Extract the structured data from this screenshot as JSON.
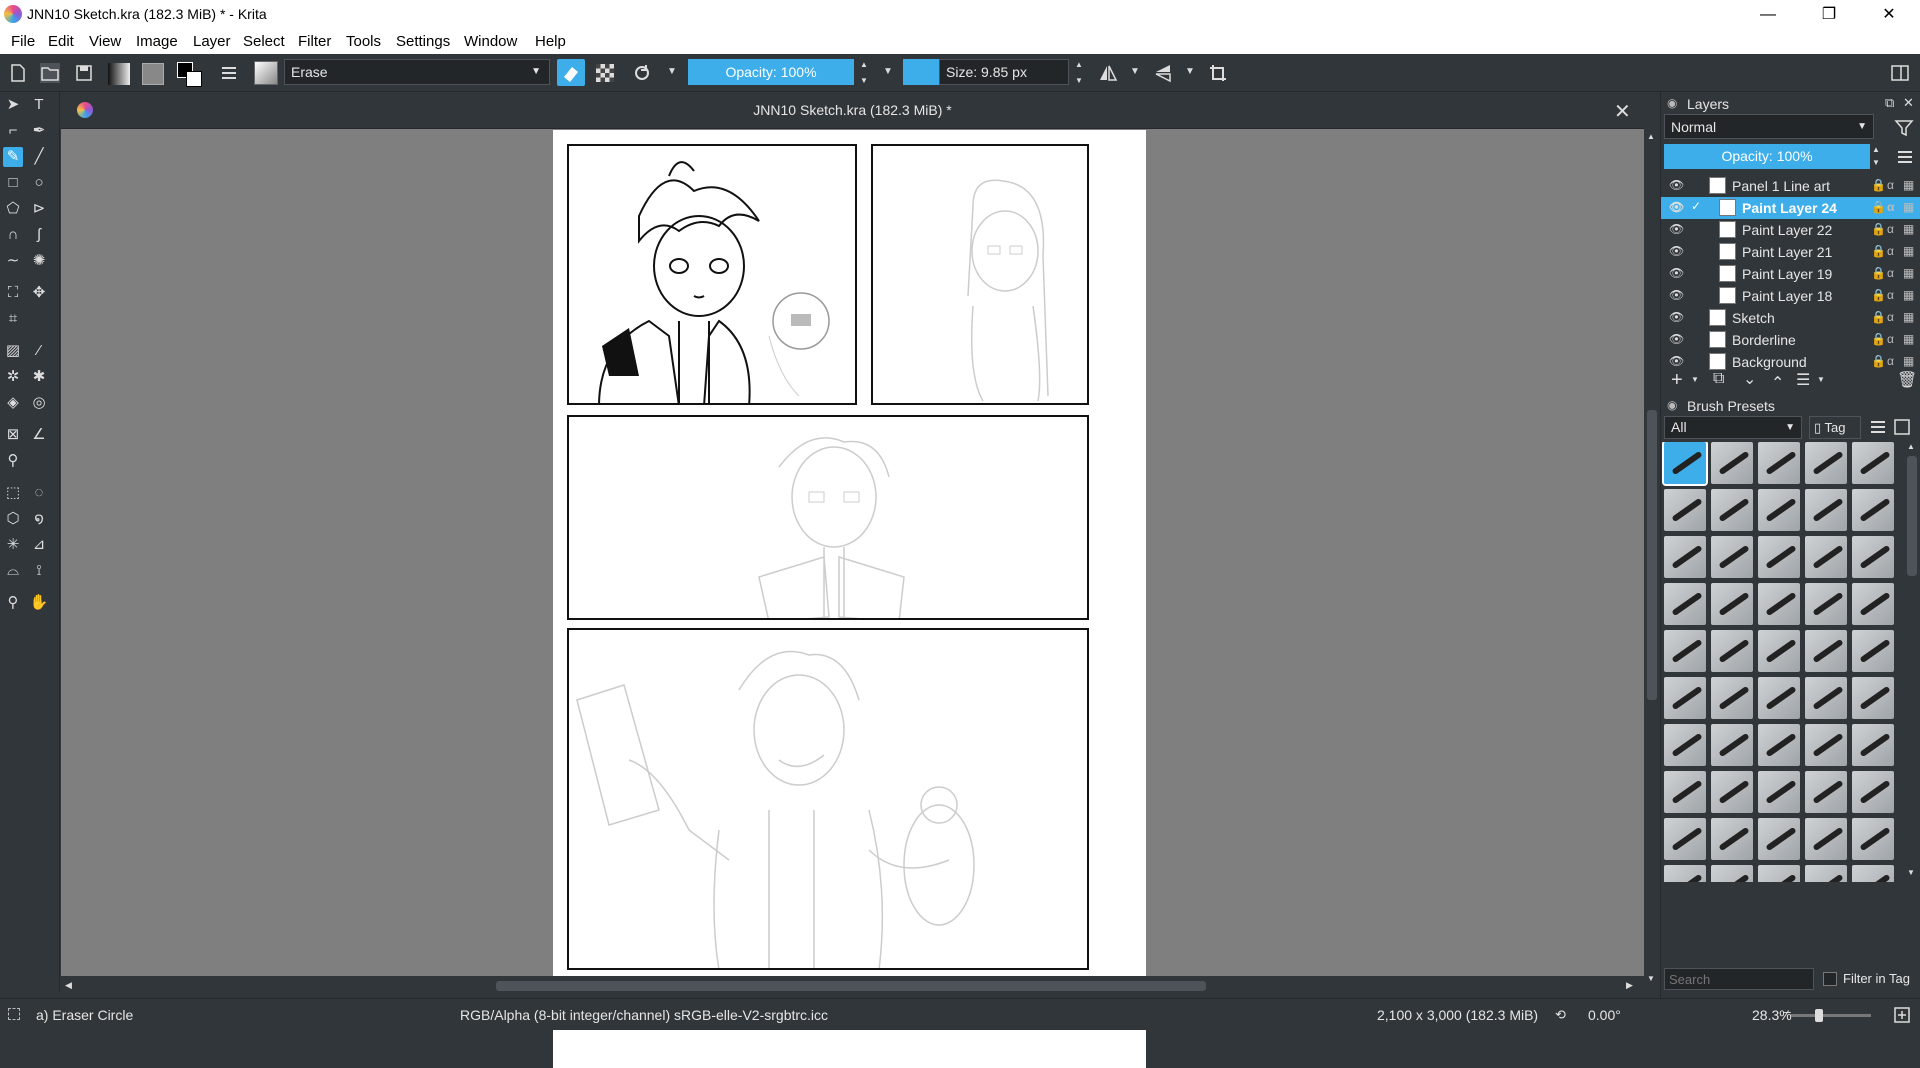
{
  "window": {
    "title": "JNN10 Sketch.kra (182.3 MiB) * - Krita",
    "minimize": "—",
    "maximize": "❐",
    "close": "✕"
  },
  "menu": [
    "File",
    "Edit",
    "View",
    "Image",
    "Layer",
    "Select",
    "Filter",
    "Tools",
    "Settings",
    "Window",
    "Help"
  ],
  "toolbar": {
    "blend_mode": "Erase",
    "opacity": "Opacity: 100%",
    "size": "Size: 9.85 px"
  },
  "document": {
    "tab_title": "JNN10 Sketch.kra (182.3 MiB) *",
    "close": "✕"
  },
  "layers_docker": {
    "title": "Layers",
    "blend_mode": "Normal",
    "opacity": "Opacity:  100%",
    "layers": [
      {
        "name": "Panel 1 Line art",
        "selected": false,
        "checked": false
      },
      {
        "name": "Paint Layer 24",
        "selected": true,
        "checked": true
      },
      {
        "name": "Paint Layer 22",
        "selected": false,
        "checked": false
      },
      {
        "name": "Paint Layer 21",
        "selected": false,
        "checked": false
      },
      {
        "name": "Paint Layer 19",
        "selected": false,
        "checked": false
      },
      {
        "name": "Paint Layer 18",
        "selected": false,
        "checked": false
      },
      {
        "name": "Sketch",
        "selected": false,
        "checked": false
      },
      {
        "name": "Borderline",
        "selected": false,
        "checked": false
      },
      {
        "name": "Background",
        "selected": false,
        "checked": false
      }
    ]
  },
  "brush_presets": {
    "title": "Brush Presets",
    "filter": "All",
    "tag": "Tag",
    "search_placeholder": "Search",
    "filter_in_tag": "Filter in Tag"
  },
  "status": {
    "brush": "a) Eraser Circle",
    "color_space": "RGB/Alpha (8-bit integer/channel)  sRGB-elle-V2-srgbtrc.icc",
    "dimensions": "2,100 x 3,000 (182.3 MiB)",
    "rotation": "0.00°",
    "zoom": "28.3%"
  }
}
